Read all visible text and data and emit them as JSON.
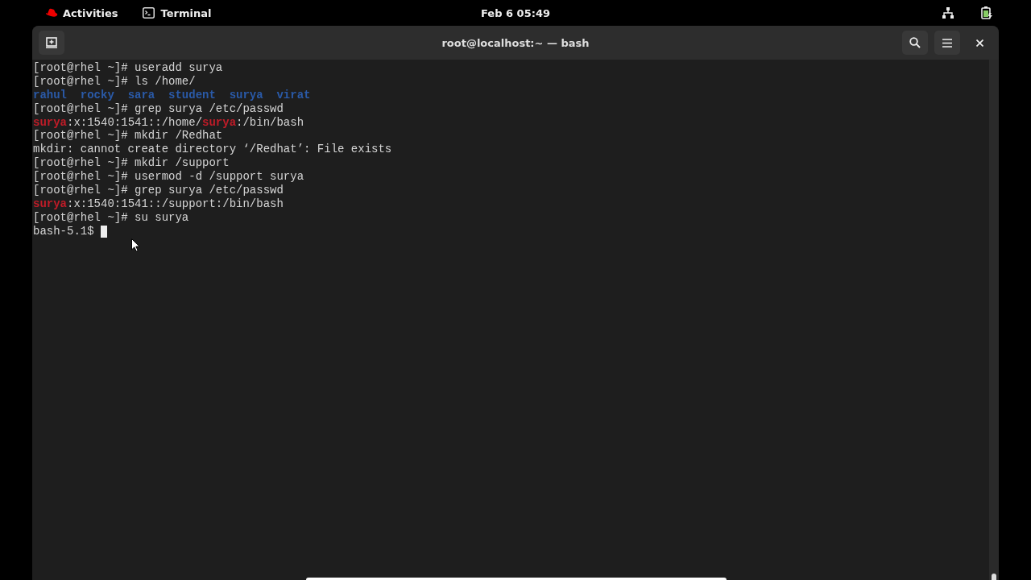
{
  "top_bar": {
    "activities": "Activities",
    "app": "Terminal",
    "clock": "Feb 6  05:49"
  },
  "window": {
    "title": "root@localhost:~ — bash"
  },
  "terminal": {
    "lines": [
      {
        "segments": [
          {
            "text": "[root@rhel ~]# useradd surya",
            "kind": "plain"
          }
        ]
      },
      {
        "segments": [
          {
            "text": "[root@rhel ~]# ls /home/",
            "kind": "plain"
          }
        ]
      },
      {
        "segments": [
          {
            "text": "rahul",
            "kind": "dir"
          },
          {
            "text": "rocky",
            "kind": "dir"
          },
          {
            "text": "sara",
            "kind": "dir"
          },
          {
            "text": "student",
            "kind": "dir"
          },
          {
            "text": "surya",
            "kind": "dir"
          },
          {
            "text": "virat",
            "kind": "dir"
          }
        ]
      },
      {
        "segments": [
          {
            "text": "[root@rhel ~]# grep surya /etc/passwd",
            "kind": "plain"
          }
        ]
      },
      {
        "segments": [
          {
            "text": "surya",
            "kind": "match"
          },
          {
            "text": ":x:1540:1541::/home/",
            "kind": "plain"
          },
          {
            "text": "surya",
            "kind": "match"
          },
          {
            "text": ":/bin/bash",
            "kind": "plain"
          }
        ]
      },
      {
        "segments": [
          {
            "text": "[root@rhel ~]# mkdir /Redhat",
            "kind": "plain"
          }
        ]
      },
      {
        "segments": [
          {
            "text": "mkdir: cannot create directory ‘/Redhat’: File exists",
            "kind": "plain"
          }
        ]
      },
      {
        "segments": [
          {
            "text": "[root@rhel ~]# mkdir /support",
            "kind": "plain"
          }
        ]
      },
      {
        "segments": [
          {
            "text": "[root@rhel ~]# usermod -d /support surya",
            "kind": "plain"
          }
        ]
      },
      {
        "segments": [
          {
            "text": "[root@rhel ~]# grep surya /etc/passwd",
            "kind": "plain"
          }
        ]
      },
      {
        "segments": [
          {
            "text": "surya",
            "kind": "match"
          },
          {
            "text": ":x:1540:1541::/support:/bin/bash",
            "kind": "plain"
          }
        ]
      },
      {
        "segments": [
          {
            "text": "[root@rhel ~]# su surya",
            "kind": "plain"
          }
        ]
      }
    ],
    "prompt": "bash-5.1$"
  }
}
